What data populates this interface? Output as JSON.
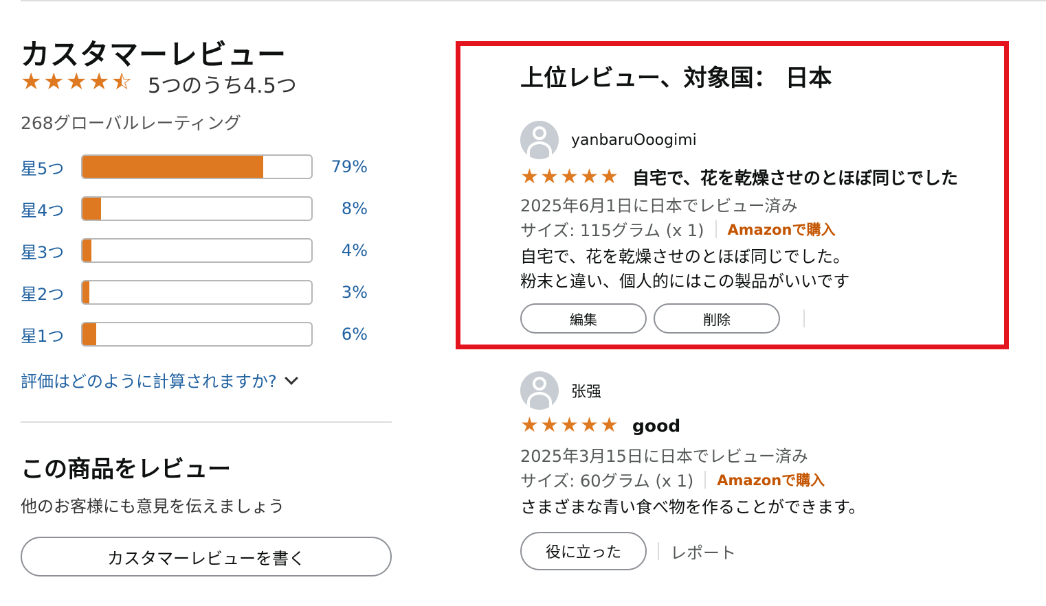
{
  "summary": {
    "title": "カスタマーレビュー",
    "stars_value": 4.5,
    "rating_text": "5つのうち4.5つ",
    "global_ratings": "268グローバルレーティング",
    "histogram": [
      {
        "label": "星5つ",
        "percent_text": "79%",
        "percent": 79
      },
      {
        "label": "星4つ",
        "percent_text": "8%",
        "percent": 8
      },
      {
        "label": "星3つ",
        "percent_text": "4%",
        "percent": 4
      },
      {
        "label": "星2つ",
        "percent_text": "3%",
        "percent": 3
      },
      {
        "label": "星1つ",
        "percent_text": "6%",
        "percent": 6
      }
    ],
    "how_calculated": "評価はどのように計算されますか?"
  },
  "write_review": {
    "title": "この商品をレビュー",
    "subtitle": "他のお客様にも意見を伝えましょう",
    "button_label": "カスタマーレビューを書く"
  },
  "top_reviews": {
    "title": "上位レビュー、対象国： 日本",
    "reviews": [
      {
        "reviewer": "yanbaruOoogimi",
        "stars": 5,
        "headline": "自宅で、花を乾燥させのとほぼ同じでした",
        "date": "2025年6月1日に日本でレビュー済み",
        "size": "サイズ: 115グラム (x 1)",
        "purchase": "Amazonで購入",
        "body_lines": [
          "自宅で、花を乾燥させのとほぼ同じでした。",
          "粉末と違い、個人的にはこの製品がいいです"
        ],
        "actions": {
          "edit": "編集",
          "delete": "削除"
        }
      },
      {
        "reviewer": "张强",
        "stars": 5,
        "headline": "good",
        "date": "2025年3月15日に日本でレビュー済み",
        "size": "サイズ: 60グラム (x 1)",
        "purchase": "Amazonで購入",
        "body_lines": [
          "さまざまな青い食べ物を作ることができます。"
        ],
        "actions": {
          "helpful": "役に立った",
          "report": "レポート"
        }
      }
    ]
  },
  "colors": {
    "star": "#de7921",
    "link": "#2162a1",
    "highlight_border": "#e3141e",
    "purchase": "#c45500"
  }
}
